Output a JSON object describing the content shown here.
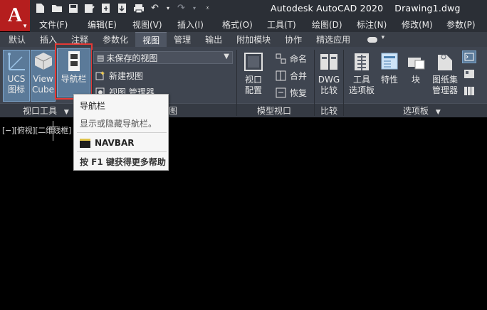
{
  "app": {
    "logo_letter": "A",
    "title": "Autodesk AutoCAD 2020",
    "document": "Drawing1.dwg"
  },
  "quick_access": {
    "icons": [
      "new-icon",
      "open-icon",
      "save-icon",
      "save-as-icon",
      "open-web-icon",
      "save-web-icon",
      "plot-icon",
      "undo-icon",
      "redo-icon",
      "customize-icon"
    ]
  },
  "menubar": {
    "items": [
      "文件(F)",
      "编辑(E)",
      "视图(V)",
      "插入(I)",
      "格式(O)",
      "工具(T)",
      "绘图(D)",
      "标注(N)",
      "修改(M)",
      "参数(P)"
    ]
  },
  "tabs": {
    "items": [
      "默认",
      "插入",
      "注释",
      "参数化",
      "视图",
      "管理",
      "输出",
      "附加模块",
      "协作",
      "精选应用"
    ],
    "active_index": 4
  },
  "ribbon": {
    "viewport_tools": {
      "ucs_icon_label_1": "UCS",
      "ucs_icon_label_2": "图标",
      "viewcube_label_1": "View",
      "viewcube_label_2": "Cube",
      "navbar_label": "导航栏",
      "panel_title": "视口工具"
    },
    "named_views": {
      "dropdown_value": "未保存的视图",
      "new_view": "新建视图",
      "view_manager": "视图 管理器",
      "panel_title_partial": "图"
    },
    "model_viewports": {
      "config_label_1": "视口",
      "config_label_2": "配置",
      "name_label": "命名",
      "join_label": "合并",
      "restore_label": "恢复",
      "panel_title": "模型视口"
    },
    "compare": {
      "dwg_label_1": "DWG",
      "dwg_label_2": "比较",
      "panel_title": "比较"
    },
    "palettes": {
      "tool_palette_1": "工具",
      "tool_palette_2": "选项板",
      "properties": "特性",
      "block": "块",
      "sheetset_1": "图纸集",
      "sheetset_2": "管理器",
      "panel_title": "选项板"
    }
  },
  "canvas": {
    "view_label": "[−][俯视][二维线框]"
  },
  "tooltip": {
    "title": "导航栏",
    "description": "显示或隐藏导航栏。",
    "command": "NAVBAR",
    "help": "按 F1 键获得更多帮助"
  },
  "colors": {
    "logo_red": "#b51e1e",
    "highlight_red": "#e53935",
    "pressed_blue": "#5b7a99"
  }
}
